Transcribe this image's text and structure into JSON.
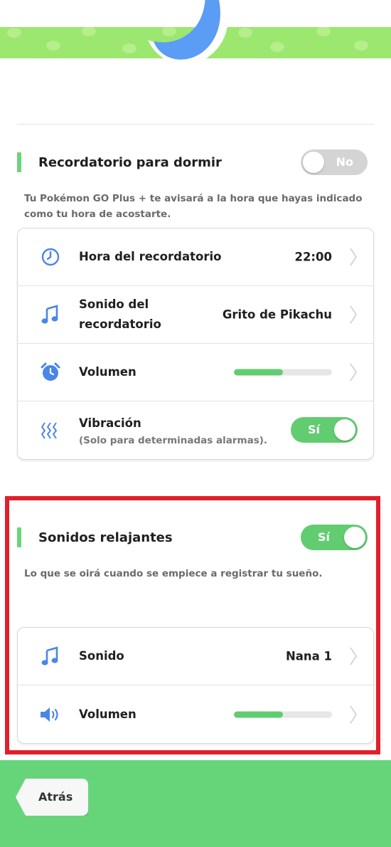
{
  "colors": {
    "accent_green": "#62cc71",
    "icon_blue": "#4a86e8",
    "highlight_red": "#e11f2b",
    "footer_green": "#66d57a",
    "banner_green": "#9be76f"
  },
  "sleep_reminder": {
    "title": "Recordatorio para dormir",
    "toggle_label": "No",
    "toggle_on": false,
    "description": "Tu Pokémon GO Plus + te avisará a la hora que hayas indicado como tu hora de acostarte.",
    "rows": [
      {
        "icon": "clock-icon",
        "label": "Hora del recordatorio",
        "value": "22:00"
      },
      {
        "icon": "music-note-icon",
        "label": "Sonido del recordatorio",
        "value": "Grito de Pikachu"
      },
      {
        "icon": "alarm-clock-icon",
        "label": "Volumen",
        "level": 0.5
      },
      {
        "icon": "vibration-icon",
        "label": "Vibración",
        "sublabel": "(Solo para determinadas alarmas).",
        "toggle_label": "Sí",
        "toggle_on": true
      }
    ]
  },
  "relaxing_sounds": {
    "title": "Sonidos relajantes",
    "toggle_label": "Sí",
    "toggle_on": true,
    "description": "Lo que se oirá cuando se empiece a registrar tu sueño.",
    "rows": [
      {
        "icon": "music-note-icon",
        "label": "Sonido",
        "value": "Nana 1"
      },
      {
        "icon": "speaker-icon",
        "label": "Volumen",
        "level": 0.5
      }
    ]
  },
  "footer": {
    "back_label": "Atrás"
  }
}
